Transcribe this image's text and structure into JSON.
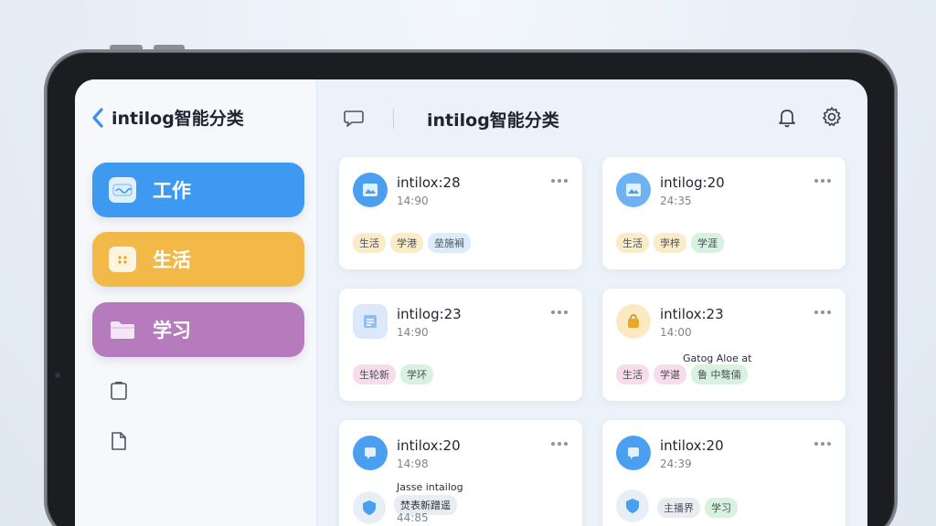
{
  "sidebar": {
    "title": "intilog智能分类",
    "categories": [
      {
        "label": "工作",
        "color": "#3e9af0"
      },
      {
        "label": "生活",
        "color": "#f2b949"
      },
      {
        "label": "学习",
        "color": "#b57bbd"
      }
    ]
  },
  "header": {
    "title": "intilog智能分类"
  },
  "cards": [
    {
      "name": "intilox:28",
      "time": "14:90",
      "tags": [
        "生活",
        "学港",
        "垒施裥"
      ]
    },
    {
      "name": "intilog:20",
      "time": "24:35",
      "tags": [
        "生活",
        "孛梓",
        "学涯"
      ]
    },
    {
      "name": "intilog:23",
      "time": "14:90",
      "tags": [
        "生轮新",
        "学环"
      ]
    },
    {
      "name": "intilox:23",
      "time": "14:00",
      "note": "Gatog Aloe at",
      "tags": [
        "生活",
        "学谌",
        "鲁 中骜倆"
      ]
    },
    {
      "name": "intilox:20",
      "time": "14:98",
      "note_line1": "Jasse intailog",
      "note_line2": "焚表新蹭遥",
      "time2": "44:85"
    },
    {
      "name": "intilox:20",
      "time": "24:39",
      "tags": [
        "主播界",
        "学习"
      ]
    }
  ],
  "colors": {
    "accent_blue": "#3e9af0",
    "accent_yellow": "#f2b949",
    "accent_purple": "#b57bbd"
  }
}
